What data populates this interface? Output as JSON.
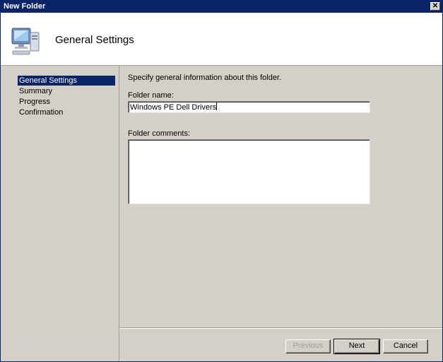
{
  "window": {
    "title": "New Folder"
  },
  "header": {
    "title": "General Settings",
    "icon": "computer-icon"
  },
  "sidebar": {
    "items": [
      {
        "label": "General Settings",
        "active": true
      },
      {
        "label": "Summary",
        "active": false
      },
      {
        "label": "Progress",
        "active": false
      },
      {
        "label": "Confirmation",
        "active": false
      }
    ]
  },
  "main": {
    "instructions": "Specify general information about this folder.",
    "folder_name_label": "Folder name:",
    "folder_name_value": "Windows PE Dell Drivers",
    "folder_comments_label": "Folder comments:",
    "folder_comments_value": ""
  },
  "buttons": {
    "previous": "Previous",
    "next": "Next",
    "cancel": "Cancel"
  },
  "colors": {
    "titlebar": "#0a246a",
    "selection": "#0a246a",
    "face": "#d4d0c8"
  }
}
